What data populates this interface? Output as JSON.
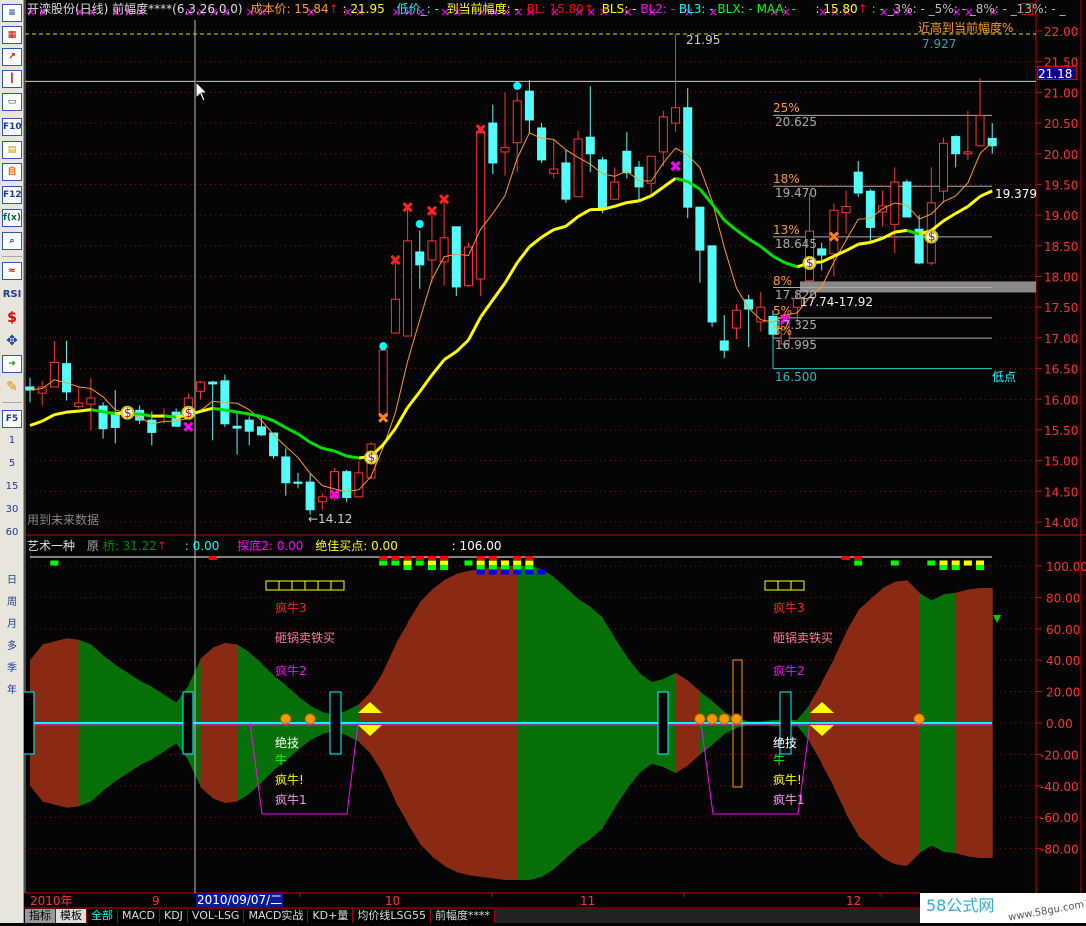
{
  "header": {
    "title": "开滦股份(日线) 前幅度****(6,3,26,0,0)",
    "cost": "成本价: 15.84",
    "arrow": "↑",
    "high": ": 21.95",
    "low": "低价_: -",
    "to_cur": "到当前幅度: -",
    "bl": "BL: 15.80",
    "bls": "BLS: -",
    "bl2": "BL2: -",
    "bl3": "BL3: -",
    "blx": "BLX: -",
    "maa": "MAA: -",
    "v1": ": 15.80",
    "v2": ": -",
    "p3": "_3%: -",
    "p5": "_5%: -",
    "p8": "_8%: -",
    "p13": "_13%: -",
    "tail": "_"
  },
  "toolbar": {
    "f10": "F10",
    "f12": "F12",
    "fx": "f(x)",
    "rsi": "RSI",
    "f5": "F5",
    "periods": [
      "1",
      "5",
      "15",
      "30",
      "60"
    ],
    "spans": [
      "日",
      "周",
      "月",
      "多",
      "季",
      "年"
    ]
  },
  "annotations": {
    "high_label": "21.95",
    "low_label": "←14.12",
    "ma_value": "19.379",
    "recent_title": "近高到当前幅度%",
    "recent_value": "7.927",
    "band": "17.74-17.92",
    "bottom_value": "16.500",
    "bottom_label": "低点",
    "future_warning": "用到未来数据",
    "crosshair_price": "21.18"
  },
  "levels": [
    {
      "pct": "25%",
      "value": "20.625"
    },
    {
      "pct": "18%",
      "value": "19.470"
    },
    {
      "pct": "13%",
      "value": "18.645"
    },
    {
      "pct": "8%",
      "value": "17.820"
    },
    {
      "pct": "5%",
      "value": "17.325"
    },
    {
      "pct": "3%",
      "value": "16.995"
    }
  ],
  "indicator": {
    "name": "艺术一种",
    "orig": "原",
    "bridge": "桥: 31.22",
    "arrow": "↑",
    "v1": ": 0.00",
    "tandi": "探底2: 0.00",
    "best": "绝佳买点: 0.00",
    "v2": ": 106.00",
    "labels": {
      "l1": "疯牛3",
      "l2": "砸锅卖铁买",
      "l3": "疯牛2",
      "l4": "绝技",
      "l5": "牛",
      "l6": "疯牛!",
      "l7": "疯牛1"
    }
  },
  "datebar": {
    "year": "2010年",
    "m9": "9",
    "cursor_date": "2010/09/07/二",
    "m10": "10",
    "m11": "11",
    "m12": "12"
  },
  "tabs": [
    "指标",
    "模板",
    "全部",
    "MACD",
    "KDJ",
    "VOL-LSG",
    "MACD实战",
    "KD+量",
    "均价线LSG55",
    "前幅度****"
  ],
  "logo": {
    "brand": "58公式网",
    "url": "www.58gu.com"
  },
  "colors": {
    "up": "#ff3232",
    "down": "#54fcfc",
    "ma_up": "#ffff00",
    "ma_down": "#00e000",
    "ma_fast": "#ff9a1e",
    "brown": "#8b2a14",
    "green": "#087008"
  },
  "chart_data": {
    "type": "candlestick",
    "price_ticks": [
      22,
      21.5,
      21,
      20.5,
      20,
      19.5,
      19,
      18.5,
      18,
      17.5,
      17,
      16.5,
      16,
      15.5,
      15,
      14.5,
      14
    ],
    "indicator_ticks": [
      100,
      80,
      60,
      40,
      20,
      0,
      -20,
      -40,
      -60,
      -80
    ],
    "candles": [
      [
        16.2,
        16.35,
        15.95,
        16.15
      ],
      [
        16.1,
        16.3,
        15.9,
        16.2
      ],
      [
        16.2,
        16.95,
        16.2,
        16.6
      ],
      [
        16.58,
        16.95,
        15.98,
        16.12
      ],
      [
        15.88,
        16.2,
        15.85,
        15.94
      ],
      [
        15.92,
        16.35,
        15.5,
        16.02
      ],
      [
        15.89,
        15.95,
        15.36,
        15.52
      ],
      [
        15.78,
        16.15,
        15.28,
        15.54
      ],
      [
        15.75,
        15.85,
        15.7,
        15.8
      ],
      [
        15.82,
        15.9,
        15.6,
        15.66
      ],
      [
        15.66,
        15.8,
        15.25,
        15.46
      ],
      [
        15.72,
        15.85,
        15.6,
        15.74
      ],
      [
        15.79,
        15.85,
        15.55,
        15.56
      ],
      [
        15.78,
        16.1,
        15.7,
        16.02
      ],
      [
        16.13,
        16.3,
        16.0,
        16.28
      ],
      [
        16.28,
        16.3,
        15.33,
        16.25
      ],
      [
        16.3,
        16.4,
        15.55,
        15.6
      ],
      [
        15.56,
        15.8,
        15.1,
        15.53
      ],
      [
        15.66,
        15.72,
        15.25,
        15.48
      ],
      [
        15.55,
        15.7,
        15.4,
        15.42
      ],
      [
        15.45,
        15.45,
        15.03,
        15.08
      ],
      [
        15.06,
        15.2,
        14.43,
        14.64
      ],
      [
        14.65,
        14.8,
        14.55,
        14.63
      ],
      [
        14.65,
        14.78,
        14.12,
        14.2
      ],
      [
        14.33,
        14.47,
        14.2,
        14.41
      ],
      [
        14.4,
        14.88,
        14.35,
        14.82
      ],
      [
        14.82,
        14.85,
        14.32,
        14.4
      ],
      [
        14.41,
        15.0,
        14.4,
        14.8
      ],
      [
        14.72,
        15.3,
        14.7,
        15.27
      ],
      [
        15.72,
        16.8,
        15.7,
        16.8
      ],
      [
        17.08,
        18.27,
        17.08,
        17.63
      ],
      [
        17.03,
        19.13,
        17.03,
        18.58
      ],
      [
        18.4,
        18.75,
        17.8,
        18.19
      ],
      [
        18.27,
        19.05,
        17.9,
        18.58
      ],
      [
        18.24,
        19.26,
        17.85,
        18.63
      ],
      [
        18.81,
        18.81,
        17.68,
        17.83
      ],
      [
        17.85,
        18.55,
        17.83,
        18.48
      ],
      [
        17.96,
        20.4,
        17.68,
        20.34
      ],
      [
        20.5,
        20.8,
        19.67,
        19.85
      ],
      [
        20.03,
        21.0,
        19.64,
        20.1
      ],
      [
        20.18,
        21.0,
        19.7,
        20.86
      ],
      [
        21.02,
        21.2,
        20.34,
        20.55
      ],
      [
        20.42,
        20.5,
        19.85,
        19.9
      ],
      [
        19.68,
        20.24,
        19.6,
        19.75
      ],
      [
        19.85,
        20.06,
        19.2,
        19.26
      ],
      [
        19.3,
        20.37,
        19.3,
        20.24
      ],
      [
        20.27,
        21.1,
        19.7,
        20.0
      ],
      [
        19.9,
        19.95,
        19.03,
        19.12
      ],
      [
        19.26,
        19.78,
        19.25,
        19.54
      ],
      [
        20.04,
        20.35,
        19.6,
        19.69
      ],
      [
        19.78,
        19.88,
        19.25,
        19.46
      ],
      [
        19.52,
        19.96,
        19.33,
        19.96
      ],
      [
        20.03,
        20.7,
        19.8,
        20.6
      ],
      [
        20.5,
        21.95,
        20.36,
        20.75
      ],
      [
        20.75,
        21.07,
        18.95,
        19.13
      ],
      [
        19.13,
        19.13,
        17.9,
        18.43
      ],
      [
        18.5,
        18.5,
        17.18,
        17.26
      ],
      [
        16.95,
        17.37,
        16.67,
        16.8
      ],
      [
        17.16,
        17.55,
        16.98,
        17.45
      ],
      [
        17.62,
        17.7,
        16.85,
        17.47
      ],
      [
        17.26,
        17.75,
        17.1,
        17.5
      ],
      [
        17.35,
        17.45,
        17.0,
        17.06
      ],
      [
        16.9,
        17.4,
        16.85,
        17.37
      ],
      [
        17.5,
        17.75,
        17.25,
        17.64
      ],
      [
        17.93,
        19.36,
        17.93,
        18.74
      ],
      [
        18.45,
        18.55,
        18.1,
        18.35
      ],
      [
        18.37,
        19.19,
        18.0,
        19.08
      ],
      [
        19.04,
        19.4,
        18.7,
        19.14
      ],
      [
        19.7,
        19.88,
        19.3,
        19.36
      ],
      [
        19.39,
        19.42,
        18.56,
        18.8
      ],
      [
        19.05,
        19.4,
        18.82,
        19.15
      ],
      [
        18.85,
        19.78,
        18.38,
        19.54
      ],
      [
        19.54,
        19.58,
        18.97,
        18.97
      ],
      [
        18.77,
        19.0,
        18.2,
        18.22
      ],
      [
        18.22,
        19.78,
        18.18,
        19.2
      ],
      [
        19.39,
        20.26,
        19.2,
        20.17
      ],
      [
        20.28,
        20.3,
        19.78,
        20.0
      ],
      [
        20.0,
        20.7,
        19.9,
        20.03
      ],
      [
        20.13,
        21.23,
        20.13,
        20.62
      ],
      [
        20.25,
        20.5,
        20.0,
        20.13
      ]
    ],
    "signals": [
      {
        "type": "bag",
        "i": 8,
        "p": 15.78
      },
      {
        "type": "bag",
        "i": 13,
        "p": 15.78
      },
      {
        "type": "bag",
        "i": 28,
        "p": 15.05
      },
      {
        "type": "bag",
        "i": 64,
        "p": 18.22
      },
      {
        "type": "bag",
        "i": 74,
        "p": 18.65
      },
      {
        "type": "xo",
        "i": 29,
        "p": 15.7
      },
      {
        "type": "xo",
        "i": 66,
        "p": 18.65
      },
      {
        "type": "xm",
        "i": 13,
        "p": 15.55
      },
      {
        "type": "xm",
        "i": 25,
        "p": 14.45
      },
      {
        "type": "xm",
        "i": 53,
        "p": 19.8
      },
      {
        "type": "xm",
        "i": 62,
        "p": 17.3
      },
      {
        "type": "dot",
        "i": 29,
        "p": 16.8
      },
      {
        "type": "dot",
        "i": 32,
        "p": 18.79
      },
      {
        "type": "dot",
        "i": 40,
        "p": 21.04
      },
      {
        "type": "xr",
        "i": 30,
        "p": 18.27
      },
      {
        "type": "xr",
        "i": 31,
        "p": 19.13
      },
      {
        "type": "xr",
        "i": 33,
        "p": 19.07
      },
      {
        "type": "xr",
        "i": 34,
        "p": 19.26
      },
      {
        "type": "xr",
        "i": 37,
        "p": 20.4
      }
    ],
    "top_marks": [
      0,
      1,
      4,
      5,
      7,
      8,
      9,
      13,
      14,
      15,
      16,
      18,
      19,
      23,
      26,
      27,
      30,
      31,
      32,
      34,
      35,
      37,
      38,
      39,
      40,
      41,
      43,
      45,
      46,
      47,
      49,
      51,
      54,
      56,
      61,
      62,
      65,
      66,
      67,
      70,
      71,
      72,
      76,
      77,
      79
    ],
    "envelope": [
      40,
      50,
      52,
      54,
      53,
      50,
      43,
      37,
      32,
      27,
      23,
      18,
      13,
      24,
      41,
      48,
      51,
      50,
      45,
      38,
      30,
      24,
      17,
      11,
      7,
      5,
      8,
      12,
      20,
      33,
      50,
      64,
      77,
      85,
      91,
      95,
      97,
      98,
      99,
      100,
      100,
      100,
      98,
      93,
      86,
      79,
      74,
      67,
      54,
      42,
      32,
      26,
      28,
      32,
      27,
      20,
      14,
      7,
      3,
      1,
      1,
      2,
      2,
      2,
      12,
      26,
      41,
      58,
      72,
      79,
      86,
      90,
      91,
      83,
      78,
      82,
      83,
      85,
      86,
      86
    ],
    "envelope_color": "rrrrggggggggggrrrggggggggggrrrrrrrrrrrrrgggggggggggggrrgggggggggrrrrrrrrrgggrrrgg",
    "indicator_marks": [
      {
        "i": 2,
        "c": [
          "",
          "#00ff00"
        ]
      },
      {
        "i": 15,
        "c": [
          "#ff0000"
        ]
      },
      {
        "i": 29,
        "c": [
          "#ff0000",
          "#00ff00"
        ]
      },
      {
        "i": 30,
        "c": [
          "#ff0000",
          "#00ff00"
        ]
      },
      {
        "i": 31,
        "c": [
          "#ff0000",
          "#ffff00",
          "#00ff00"
        ]
      },
      {
        "i": 32,
        "c": [
          "#ff0000",
          "#00ff00"
        ]
      },
      {
        "i": 33,
        "c": [
          "#ff0000",
          "#ffff00",
          "#00ff00"
        ]
      },
      {
        "i": 34,
        "c": [
          "#ff0000",
          "#ffff00",
          "#00ff00"
        ]
      },
      {
        "i": 36,
        "c": [
          "",
          "#00ff00"
        ]
      },
      {
        "i": 37,
        "c": [
          "#ff0000",
          "#ffff00",
          "#00ff00",
          "#0000ff"
        ]
      },
      {
        "i": 38,
        "c": [
          "#ff0000",
          "#ffff00",
          "#00ff00",
          "#0000ff"
        ]
      },
      {
        "i": 39,
        "c": [
          "",
          "#ffff00",
          "#00ff00",
          "#0000ff"
        ]
      },
      {
        "i": 40,
        "c": [
          "#ff0000",
          "#ffff00",
          "#00ff00",
          "#0000ff"
        ]
      },
      {
        "i": 41,
        "c": [
          "#ff0000",
          "#ffff00",
          "#00ff00",
          "#0000ff"
        ]
      },
      {
        "i": 42,
        "c": [
          "",
          "",
          "",
          "#0000ff"
        ]
      },
      {
        "i": 67,
        "c": [
          "#ff0000"
        ]
      },
      {
        "i": 68,
        "c": [
          "#ff0000",
          "#00ff00"
        ]
      },
      {
        "i": 71,
        "c": [
          "",
          "#00ff00"
        ]
      },
      {
        "i": 74,
        "c": [
          "",
          "#00ff00"
        ]
      },
      {
        "i": 75,
        "c": [
          "",
          "#ffff00",
          "#00ff00"
        ]
      },
      {
        "i": 76,
        "c": [
          "",
          "#ffff00",
          "#00ff00"
        ]
      },
      {
        "i": 77,
        "c": [
          "",
          "#ffff00"
        ]
      },
      {
        "i": 78,
        "c": [
          "",
          "#ffff00",
          "#00ff00"
        ]
      }
    ],
    "oranges": [
      21,
      23,
      55,
      56,
      57,
      58,
      73
    ]
  }
}
